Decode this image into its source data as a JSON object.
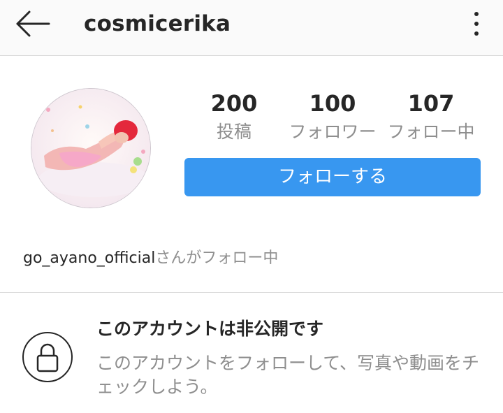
{
  "header": {
    "back_icon": "arrow-left-icon",
    "username": "cosmicerika",
    "menu_icon": "more-vertical-icon"
  },
  "profile": {
    "avatar": "profile-photo",
    "stats": [
      {
        "value": "200",
        "label": "投稿"
      },
      {
        "value": "100",
        "label": "フォロワー"
      },
      {
        "value": "107",
        "label": "フォロー中"
      }
    ],
    "follow_button_label": "フォローする",
    "followed_by_user": "go_ayano_official",
    "followed_by_suffix": "さんがフォロー中"
  },
  "private_notice": {
    "icon": "lock-icon",
    "title": "このアカウントは非公開です",
    "description": "このアカウントをフォローして、写真や動画をチェックしよう。"
  },
  "colors": {
    "accent": "#3897f0",
    "text_primary": "#262626",
    "text_secondary": "#8e8e8e",
    "divider": "#dbdbdb",
    "topbar_bg": "#fafafa"
  }
}
